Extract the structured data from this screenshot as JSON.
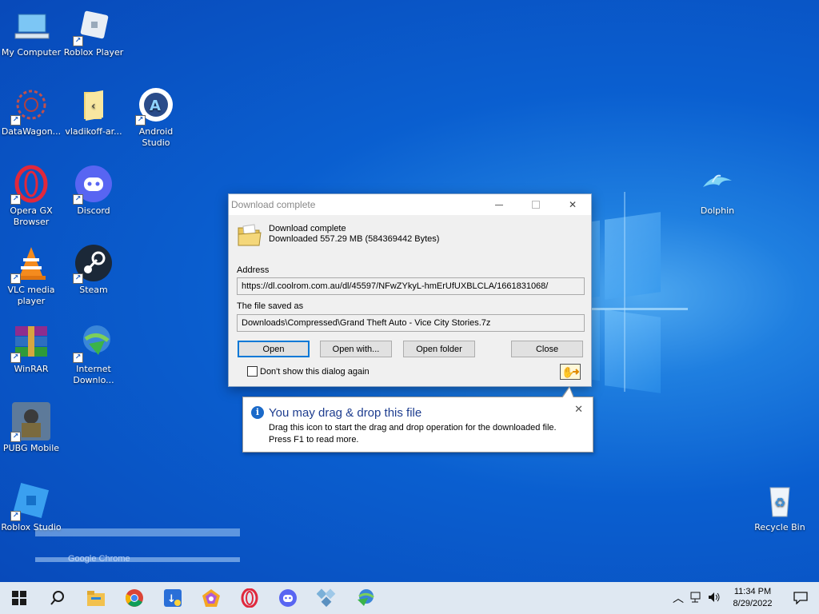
{
  "desktop": {
    "icons": [
      {
        "label": "My Computer"
      },
      {
        "label": "Roblox Player"
      },
      {
        "label": "DataWagon..."
      },
      {
        "label": "vladikoff-ar..."
      },
      {
        "label": "Android Studio"
      },
      {
        "label": "Opera GX Browser"
      },
      {
        "label": "Discord"
      },
      {
        "label": "VLC media player"
      },
      {
        "label": "Steam"
      },
      {
        "label": "WinRAR"
      },
      {
        "label": "Internet Downlo..."
      },
      {
        "label": "PUBG Mobile"
      },
      {
        "label": "Roblox Studio"
      },
      {
        "label": "Dolphin"
      },
      {
        "label": "Recycle Bin"
      }
    ],
    "ghost_text": "Google Chrome"
  },
  "dialog": {
    "title": "Download complete",
    "heading": "Download complete",
    "downloaded": "Downloaded 557.29  MB (584369442 Bytes)",
    "address_label": "Address",
    "address_value": "https://dl.coolrom.com.au/dl/45597/NFwZYkyL-hmErUfUXBLCLA/1661831068/",
    "saved_label": "The file saved as",
    "saved_value": "Downloads\\Compressed\\Grand Theft Auto - Vice City Stories.7z",
    "buttons": {
      "open": "Open",
      "open_with": "Open with...",
      "open_folder": "Open folder",
      "close": "Close"
    },
    "checkbox_label": "Don't show this dialog again"
  },
  "balloon": {
    "title": "You may drag & drop this file",
    "line1": "Drag this icon to start the drag and drop operation for the downloaded file.",
    "line2": "Press F1 to read more."
  },
  "taskbar": {
    "time": "11:34 PM",
    "date": "8/29/2022"
  },
  "colors": {
    "desktop_blue": "#0a5fd0",
    "accent": "#0078d7",
    "balloon_title": "#1e3d8f"
  }
}
